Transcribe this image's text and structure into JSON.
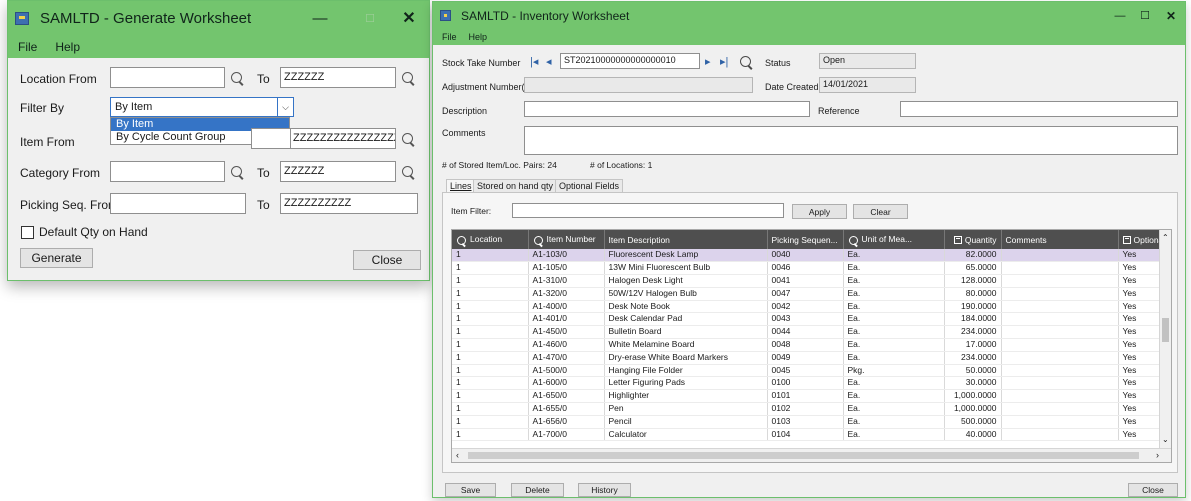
{
  "generate_window": {
    "title": "SAMLTD - Generate Worksheet",
    "menu": [
      "File",
      "Help"
    ],
    "location_from_label": "Location From",
    "location_from_value": "",
    "to_label": "To",
    "location_to_value": "ZZZZZZ",
    "filter_by_label": "Filter By",
    "filter_by_value": "By Item",
    "filter_options": [
      "By Item",
      "By Cycle Count Group"
    ],
    "item_from_label": "Item From",
    "item_to_value": "ZZZZZZZZZZZZZZZZZZZZZZZZ",
    "category_from_label": "Category From",
    "category_to_value": "ZZZZZZ",
    "picking_seq_label": "Picking Seq. From",
    "picking_seq_to_value": "ZZZZZZZZZZ",
    "default_qty_label": "Default Qty on Hand",
    "generate_label": "Generate",
    "close_label": "Close",
    "minimize": "—",
    "close_glyph": "✕"
  },
  "inventory_window": {
    "title": "SAMLTD - Inventory Worksheet",
    "menu": [
      "File",
      "Help"
    ],
    "stock_take_label": "Stock Take Number",
    "stock_take_value": "ST20210000000000000010",
    "status_label": "Status",
    "status_value": "Open",
    "adjustment_label": "Adjustment Number(s)",
    "adjustment_value": "",
    "date_created_label": "Date Created",
    "date_created_value": "14/01/2021",
    "description_label": "Description",
    "description_value": "",
    "reference_label": "Reference",
    "reference_value": "",
    "comments_label": "Comments",
    "comments_value": "",
    "stored_pairs_text": "# of Stored Item/Loc. Pairs:  24",
    "locations_text": "# of Locations:   1",
    "tabs": [
      "Lines",
      "Stored on hand qty",
      "Optional Fields"
    ],
    "item_filter_label": "Item Filter:",
    "item_filter_value": "",
    "apply_label": "Apply",
    "clear_label": "Clear",
    "columns": [
      "Location",
      "Item Number",
      "Item Description",
      "Picking Sequen...",
      "Unit of Mea...",
      "Quantity",
      "Comments",
      "Optiona"
    ],
    "rows": [
      [
        "1",
        "A1-103/0",
        "Fluorescent Desk Lamp",
        "0040",
        "Ea.",
        "82.0000",
        "",
        "Yes"
      ],
      [
        "1",
        "A1-105/0",
        "13W Mini Fluorescent Bulb",
        "0046",
        "Ea.",
        "65.0000",
        "",
        "Yes"
      ],
      [
        "1",
        "A1-310/0",
        "Halogen Desk Light",
        "0041",
        "Ea.",
        "128.0000",
        "",
        "Yes"
      ],
      [
        "1",
        "A1-320/0",
        "50W/12V Halogen Bulb",
        "0047",
        "Ea.",
        "80.0000",
        "",
        "Yes"
      ],
      [
        "1",
        "A1-400/0",
        "Desk Note Book",
        "0042",
        "Ea.",
        "190.0000",
        "",
        "Yes"
      ],
      [
        "1",
        "A1-401/0",
        "Desk Calendar Pad",
        "0043",
        "Ea.",
        "184.0000",
        "",
        "Yes"
      ],
      [
        "1",
        "A1-450/0",
        "Bulletin Board",
        "0044",
        "Ea.",
        "234.0000",
        "",
        "Yes"
      ],
      [
        "1",
        "A1-460/0",
        "White Melamine Board",
        "0048",
        "Ea.",
        "17.0000",
        "",
        "Yes"
      ],
      [
        "1",
        "A1-470/0",
        "Dry-erase White Board Markers",
        "0049",
        "Ea.",
        "234.0000",
        "",
        "Yes"
      ],
      [
        "1",
        "A1-500/0",
        "Hanging File Folder",
        "0045",
        "Pkg.",
        "50.0000",
        "",
        "Yes"
      ],
      [
        "1",
        "A1-600/0",
        "Letter Figuring Pads",
        "0100",
        "Ea.",
        "30.0000",
        "",
        "Yes"
      ],
      [
        "1",
        "A1-650/0",
        "Highlighter",
        "0101",
        "Ea.",
        "1,000.0000",
        "",
        "Yes"
      ],
      [
        "1",
        "A1-655/0",
        "Pen",
        "0102",
        "Ea.",
        "1,000.0000",
        "",
        "Yes"
      ],
      [
        "1",
        "A1-656/0",
        "Pencil",
        "0103",
        "Ea.",
        "500.0000",
        "",
        "Yes"
      ],
      [
        "1",
        "A1-700/0",
        "Calculator",
        "0104",
        "Ea.",
        "40.0000",
        "",
        "Yes"
      ]
    ],
    "save_label": "Save",
    "delete_label": "Delete",
    "history_label": "History",
    "close_label": "Close",
    "minimize": "—",
    "maximize": "☐",
    "close_glyph": "✕"
  },
  "colors": {
    "titlebar": "#73c56e",
    "selected_row": "#dcd3ec",
    "dropdown_highlight": "#3574c6",
    "grid_header": "#4f4f4f"
  }
}
